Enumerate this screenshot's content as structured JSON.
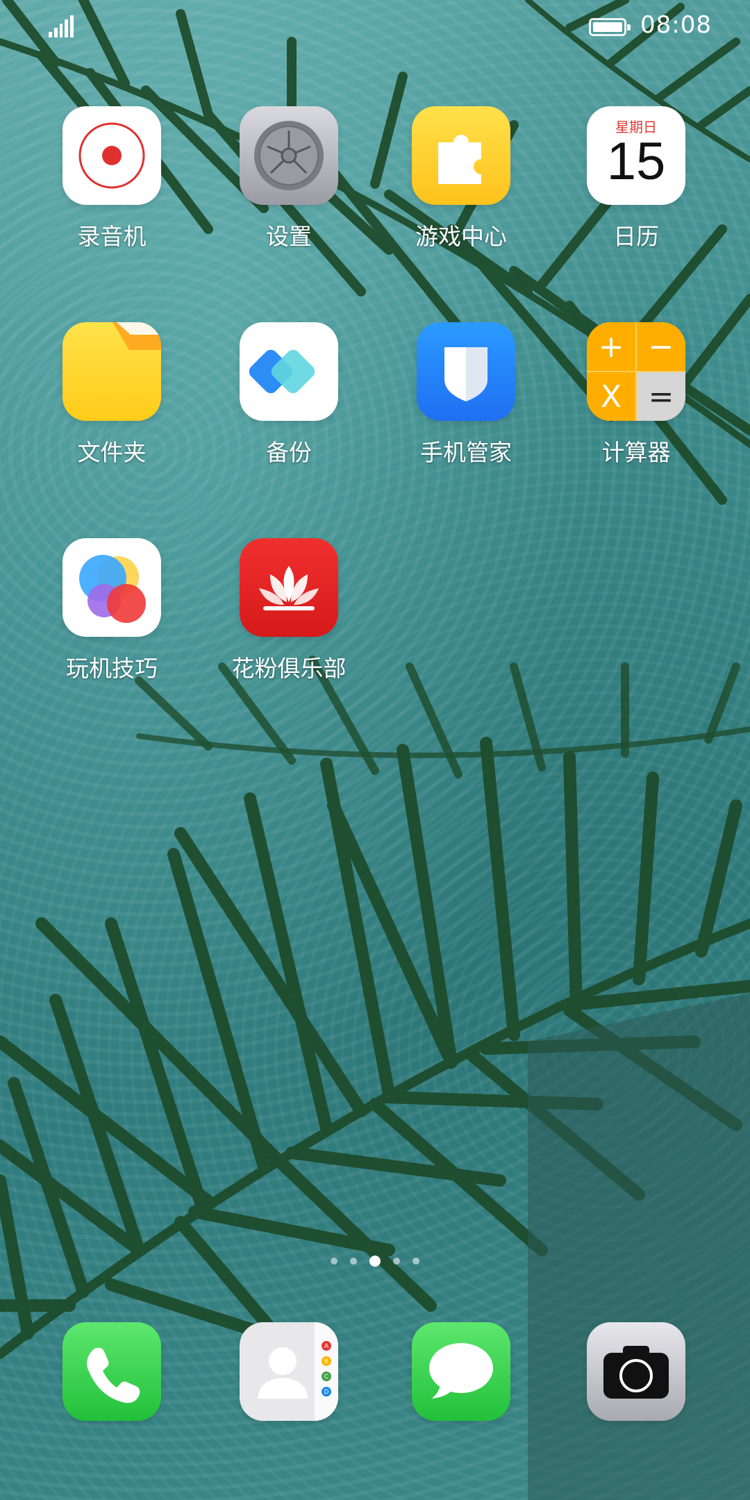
{
  "status_bar": {
    "time": "08:08"
  },
  "apps": [
    {
      "label": "录音机"
    },
    {
      "label": "设置"
    },
    {
      "label": "游戏中心"
    },
    {
      "label": "日历",
      "weekday": "星期日",
      "day": "15"
    },
    {
      "label": "文件夹"
    },
    {
      "label": "备份"
    },
    {
      "label": "手机管家"
    },
    {
      "label": "计算器",
      "keys": [
        "+",
        "−",
        "X",
        "="
      ]
    },
    {
      "label": "玩机技巧"
    },
    {
      "label": "花粉俱乐部"
    }
  ],
  "page_indicator": {
    "count": 5,
    "active_index": 2
  },
  "dock": [
    {
      "name": "phone-icon"
    },
    {
      "name": "contacts-icon",
      "letters": [
        "A",
        "B",
        "C",
        "D"
      ]
    },
    {
      "name": "messages-icon"
    },
    {
      "name": "camera-icon"
    }
  ],
  "colors": {
    "wallpaper": "#3f8d8e",
    "palm_leaf": "#1f4d2a",
    "accent_red": "#e53935"
  }
}
